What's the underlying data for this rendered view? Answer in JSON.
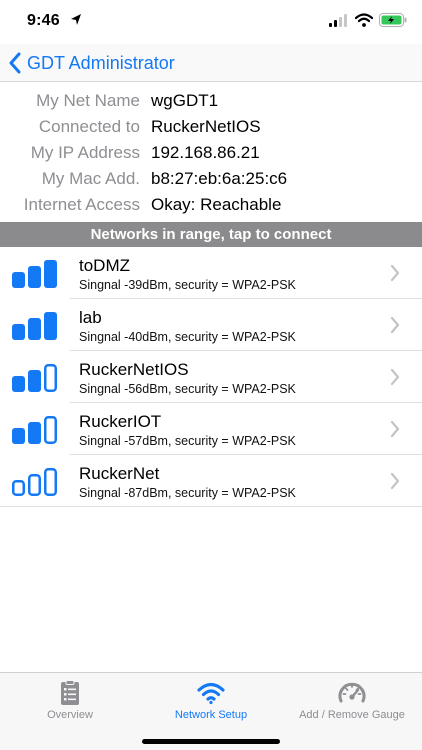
{
  "status_bar": {
    "time": "9:46",
    "location_icon": "location-arrow-icon",
    "cell_icon": "cellular-signal-icon",
    "wifi_icon": "wifi-icon",
    "battery_icon": "battery-charging-icon",
    "battery_color": "#34c759"
  },
  "nav": {
    "back_label": "GDT Administrator",
    "back_icon": "chevron-left-icon",
    "accent": "#1479f5"
  },
  "info": [
    {
      "label": "My Net Name",
      "value": "wgGDT1"
    },
    {
      "label": "Connected to",
      "value": "RuckerNetIOS"
    },
    {
      "label": "My IP Address",
      "value": "192.168.86.21"
    },
    {
      "label": "My Mac Add.",
      "value": "b8:27:eb:6a:25:c6"
    },
    {
      "label": "Internet Access",
      "value": "Okay: Reachable"
    }
  ],
  "section_header": "Networks in range, tap to connect",
  "networks": [
    {
      "name": "toDMZ",
      "detail": "Singnal -39dBm, security = WPA2-PSK",
      "bars": 3
    },
    {
      "name": "lab",
      "detail": "Singnal -40dBm, security = WPA2-PSK",
      "bars": 3
    },
    {
      "name": "RuckerNetIOS",
      "detail": "Singnal -56dBm, security = WPA2-PSK",
      "bars": 2
    },
    {
      "name": "RuckerIOT",
      "detail": "Singnal -57dBm, security = WPA2-PSK",
      "bars": 2
    },
    {
      "name": "RuckerNet",
      "detail": "Singnal -87dBm, security = WPA2-PSK",
      "bars": 0
    }
  ],
  "tabs": [
    {
      "label": "Overview",
      "icon": "clipboard-list-icon",
      "active": false
    },
    {
      "label": "Network Setup",
      "icon": "wifi-icon",
      "active": true
    },
    {
      "label": "Add / Remove Gauge",
      "icon": "speedometer-gauge-icon",
      "active": false
    }
  ],
  "colors": {
    "signal_blue": "#1479f5",
    "header_gray": "#8b8b8d",
    "inactive_gray": "#8e8e93"
  }
}
